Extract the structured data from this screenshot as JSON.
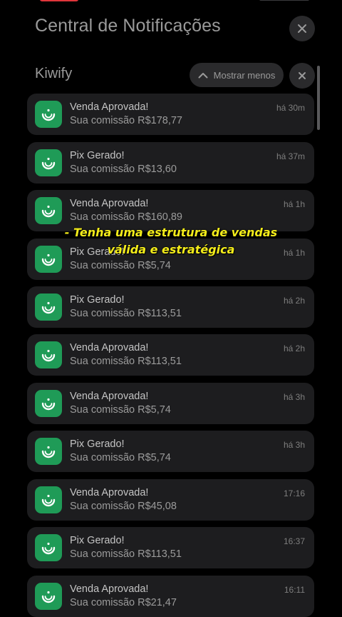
{
  "header": {
    "title": "Central de Notificações"
  },
  "group": {
    "app_name": "Kiwify",
    "show_less_label": "Mostrar menos"
  },
  "overlay_caption": {
    "line1": "- Tenha  uma estrutura de vendas",
    "line2": "válida e estratégica"
  },
  "colors": {
    "background": "#000000",
    "card": "#1d1d1f",
    "app_icon": "#1f9b57",
    "caption": "#f3ec1a"
  },
  "icons": {
    "app": "kiwify-logo-icon",
    "close": "close-icon",
    "collapse": "chevron-up-icon"
  },
  "notifications": [
    {
      "title": "Venda Aprovada!",
      "body": "Sua comissão R$178,77",
      "time": "há 30m"
    },
    {
      "title": "Pix Gerado!",
      "body": "Sua comissão R$13,60",
      "time": "há 37m"
    },
    {
      "title": "Venda Aprovada!",
      "body": "Sua comissão R$160,89",
      "time": "há 1h"
    },
    {
      "title": "Pix Gerado!",
      "body": "Sua comissão R$5,74",
      "time": "há 1h"
    },
    {
      "title": "Pix Gerado!",
      "body": "Sua comissão R$113,51",
      "time": "há 2h"
    },
    {
      "title": "Venda Aprovada!",
      "body": "Sua comissão R$113,51",
      "time": "há 2h"
    },
    {
      "title": "Venda Aprovada!",
      "body": "Sua comissão R$5,74",
      "time": "há 3h"
    },
    {
      "title": "Pix Gerado!",
      "body": "Sua comissão R$5,74",
      "time": "há 3h"
    },
    {
      "title": "Venda Aprovada!",
      "body": "Sua comissão R$45,08",
      "time": "17:16"
    },
    {
      "title": "Pix Gerado!",
      "body": "Sua comissão R$113,51",
      "time": "16:37"
    },
    {
      "title": "Venda Aprovada!",
      "body": "Sua comissão R$21,47",
      "time": "16:11"
    }
  ]
}
